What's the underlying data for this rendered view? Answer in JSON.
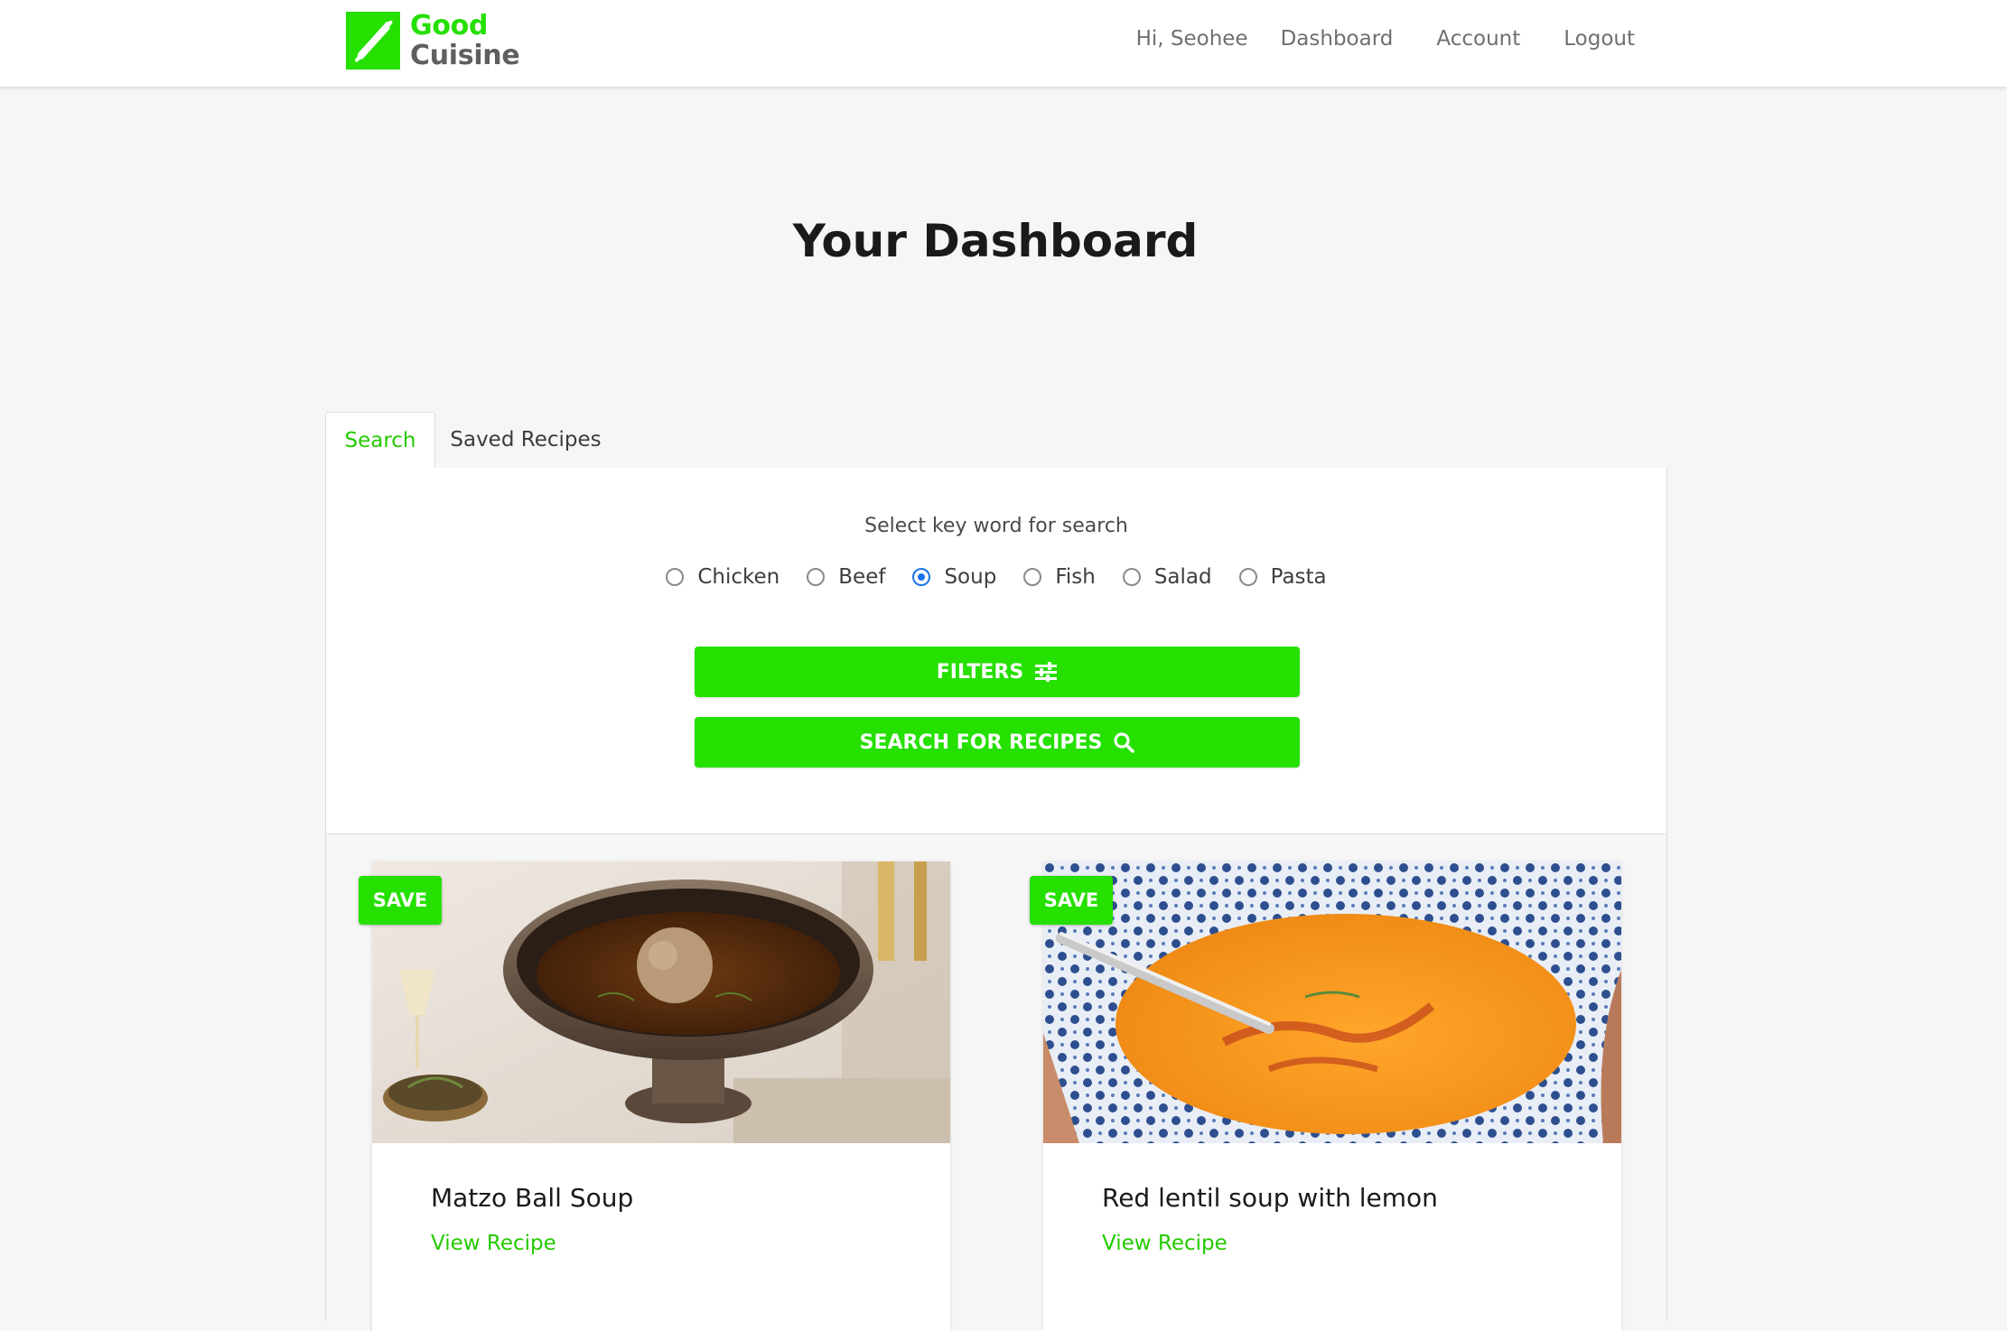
{
  "brand": {
    "name_line1": "Good",
    "name_line2": "Cuisine",
    "color": "#25e000",
    "icon": "rolling-pin-icon"
  },
  "nav": {
    "greeting": "Hi, Seohee",
    "links": [
      "Dashboard",
      "Account",
      "Logout"
    ]
  },
  "page": {
    "title": "Your Dashboard"
  },
  "tabs": [
    {
      "label": "Search",
      "active": true
    },
    {
      "label": "Saved Recipes",
      "active": false
    }
  ],
  "search": {
    "prompt": "Select key word for search",
    "keywords": [
      {
        "label": "Chicken",
        "checked": false
      },
      {
        "label": "Beef",
        "checked": false
      },
      {
        "label": "Soup",
        "checked": true
      },
      {
        "label": "Fish",
        "checked": false
      },
      {
        "label": "Salad",
        "checked": false
      },
      {
        "label": "Pasta",
        "checked": false
      }
    ],
    "filters_label": "FILTERS",
    "filters_icon": "sliders-icon",
    "search_label": "SEARCH FOR RECIPES",
    "search_icon": "search-icon"
  },
  "results": [
    {
      "save_label": "SAVE",
      "title": "Matzo Ball Soup",
      "link": "View Recipe",
      "image": "matzo-ball-soup-photo"
    },
    {
      "save_label": "SAVE",
      "title": "Red lentil soup with lemon",
      "link": "View Recipe",
      "image": "red-lentil-soup-photo"
    }
  ]
}
